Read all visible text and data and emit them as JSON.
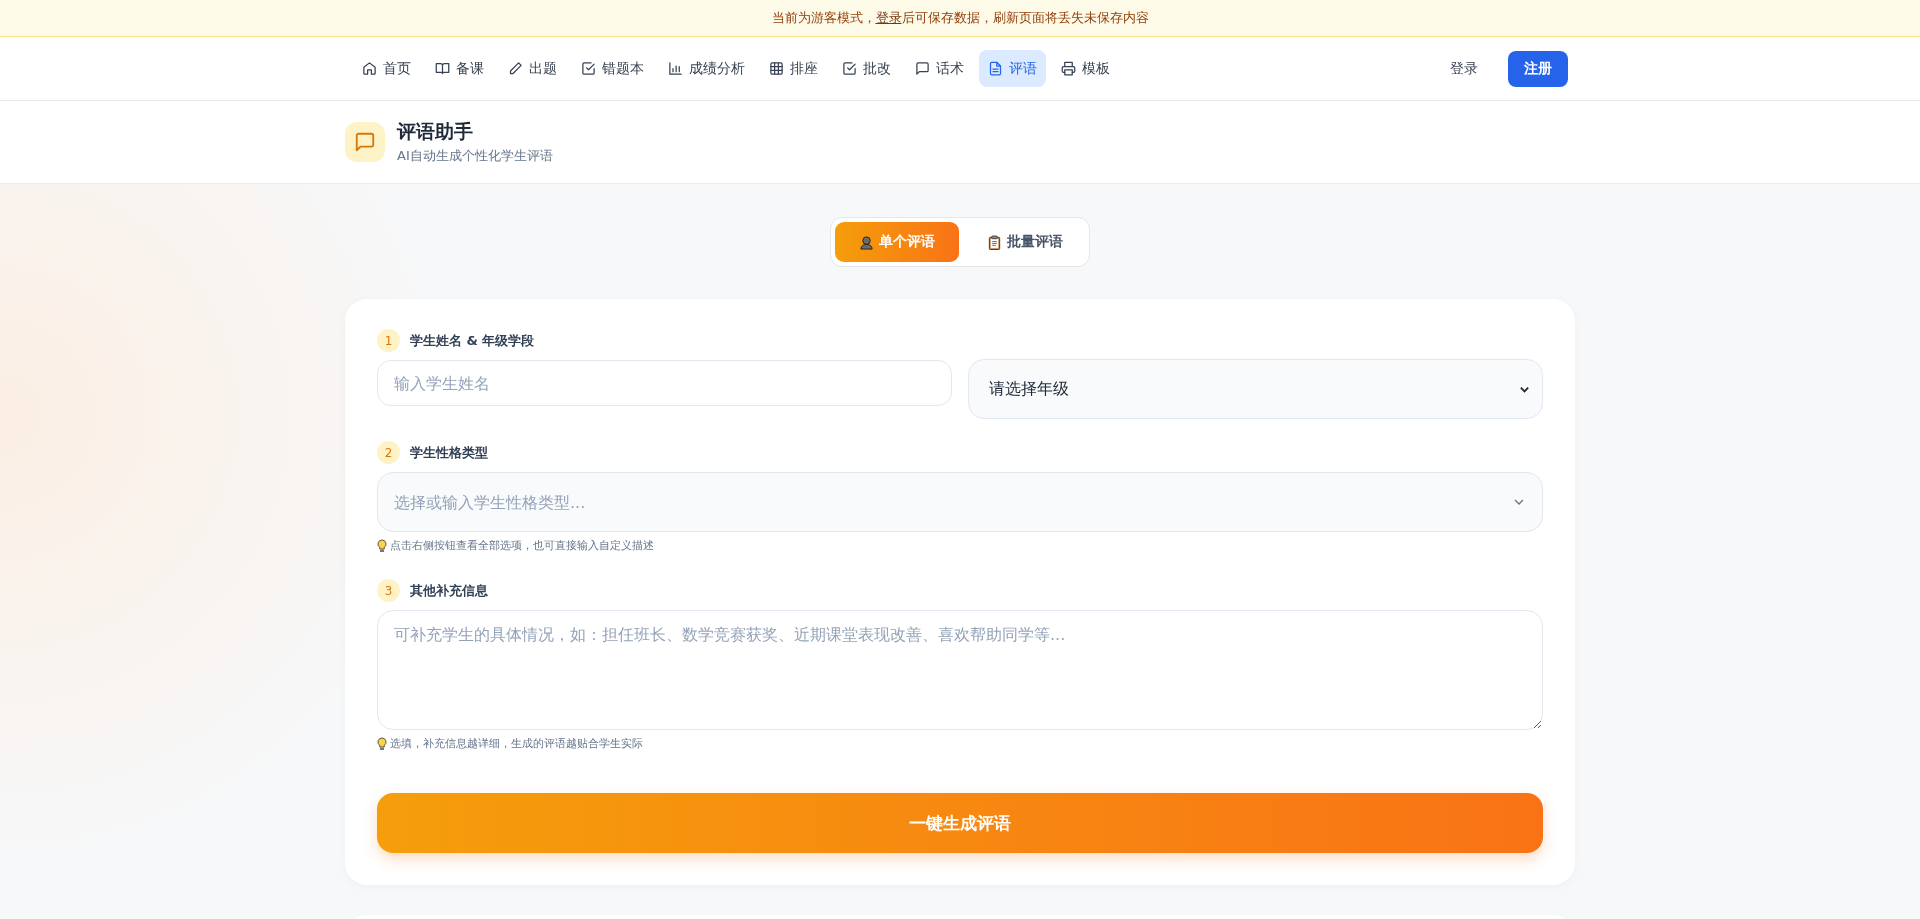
{
  "notice": {
    "before": "当前为游客模式，",
    "link": "登录",
    "after": "后可保存数据，刷新页面将丢失未保存内容"
  },
  "nav": {
    "items": [
      {
        "label": "首页",
        "kind": "home",
        "selected": false
      },
      {
        "label": "备课",
        "kind": "book",
        "selected": false
      },
      {
        "label": "出题",
        "kind": "pencil",
        "selected": false
      },
      {
        "label": "错题本",
        "kind": "check",
        "selected": false
      },
      {
        "label": "成绩分析",
        "kind": "chart",
        "selected": false
      },
      {
        "label": "排座",
        "kind": "grid",
        "selected": false
      },
      {
        "label": "批改",
        "kind": "check",
        "selected": false
      },
      {
        "label": "话术",
        "kind": "chat",
        "selected": false
      },
      {
        "label": "评语",
        "kind": "doc",
        "selected": true
      },
      {
        "label": "模板",
        "kind": "printer",
        "selected": false
      }
    ],
    "login": "登录",
    "register": "注册"
  },
  "header": {
    "title": "评语助手",
    "subtitle": "AI自动生成个性化学生评语"
  },
  "mode_tabs": [
    {
      "label": "单个评语",
      "kind": "single",
      "selected": true
    },
    {
      "label": "批量评语",
      "kind": "batch",
      "selected": false
    }
  ],
  "form": {
    "steps": [
      {
        "number": "1",
        "label": "学生姓名 & 年级学段"
      },
      {
        "number": "2",
        "label": "学生性格类型"
      },
      {
        "number": "3",
        "label": "其他补充信息"
      }
    ],
    "name_field": {
      "placeholder": "输入学生姓名"
    },
    "grade_select": {
      "value": "请选择年级"
    },
    "personality_field": {
      "placeholder": "选择或输入学生性格类型..."
    },
    "personality_hint": "点击右侧按钮查看全部选项，也可直接输入自定义描述",
    "extra_field": {
      "placeholder": "可补充学生的具体情况，如：担任班长、数学竞赛获奖、近期课堂表现改善、喜欢帮助同学等..."
    },
    "extra_hint": "选填，补充信息越详细，生成的评语越贴合学生实际",
    "submit": "一键生成评语"
  }
}
